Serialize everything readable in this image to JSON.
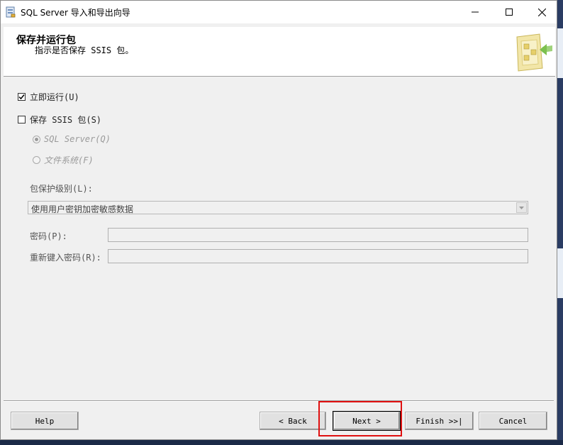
{
  "window": {
    "title": "SQL Server 导入和导出向导"
  },
  "header": {
    "title": "保存并运行包",
    "subtitle": "指示是否保存 SSIS 包。"
  },
  "options": {
    "run_immediately": {
      "label": "立即运行(U)",
      "checked": true
    },
    "save_ssis": {
      "label": "保存 SSIS 包(S)",
      "checked": false
    },
    "radio_sql_server": {
      "label": "SQL Server(Q)",
      "selected": true,
      "enabled": false
    },
    "radio_file_system": {
      "label": "文件系统(F)",
      "selected": false,
      "enabled": false
    }
  },
  "protection": {
    "label": "包保护级别(L):",
    "selected": "使用用户密钥加密敏感数据"
  },
  "password": {
    "label": "密码(P):",
    "value": ""
  },
  "reenter_password": {
    "label": "重新键入密码(R):",
    "value": ""
  },
  "buttons": {
    "help": "Help",
    "back": "< Back",
    "next": "Next >",
    "finish": "Finish >>|",
    "cancel": "Cancel"
  }
}
